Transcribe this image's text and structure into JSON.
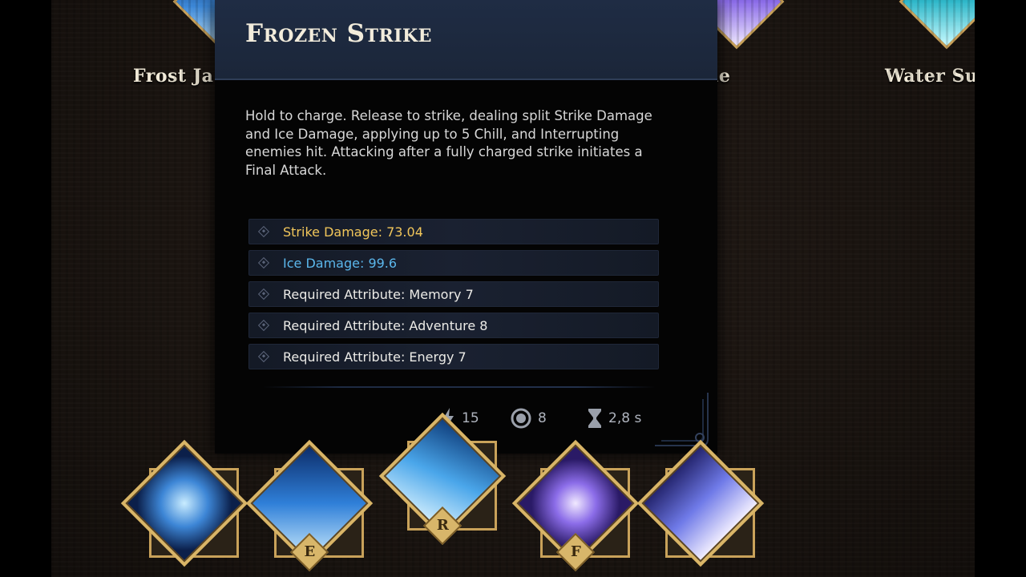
{
  "background_skills": [
    {
      "label": "Frost Ja",
      "key": "frost-javelin"
    },
    {
      "label": "le",
      "key": "hidden-skill"
    },
    {
      "label": "Water Su",
      "key": "water-surge"
    }
  ],
  "tooltip": {
    "title": "Frozen Strike",
    "description": "Hold to charge. Release to strike, dealing split Strike Damage and Ice Damage, applying up to 5 Chill, and Interrupting enemies hit. Attacking after a fully charged strike initiates a Final Attack.",
    "stats": [
      {
        "text": "Strike Damage: 73.04",
        "kind": "strike"
      },
      {
        "text": "Ice Damage: 99.6",
        "kind": "ice"
      },
      {
        "text": "Required Attribute: Memory 7",
        "kind": "req"
      },
      {
        "text": "Required Attribute: Adventure 8",
        "kind": "req"
      },
      {
        "text": "Required Attribute: Energy 7",
        "kind": "req"
      }
    ],
    "footer": {
      "energy_cost": "15",
      "charges": "8",
      "cooldown": "2,8 s"
    }
  },
  "hotbar": {
    "slots": [
      {
        "key_label": "",
        "icon": "frozen-claw-icon",
        "colors": [
          "#0b1f4a",
          "#3d86d6",
          "#c9ecff"
        ]
      },
      {
        "key_label": "E",
        "icon": "ice-shard-icon",
        "colors": [
          "#0b2a66",
          "#2f7fd8",
          "#d6f2ff"
        ]
      },
      {
        "key_label": "R",
        "icon": "ice-spear-icon",
        "colors": [
          "#0e3c7a",
          "#4aa6ea",
          "#e1f6ff"
        ]
      },
      {
        "key_label": "F",
        "icon": "vortex-icon",
        "colors": [
          "#2a1a66",
          "#8b6ce8",
          "#f1e9ff"
        ]
      },
      {
        "key_label": "",
        "icon": "arrow-burst-icon",
        "colors": [
          "#22226a",
          "#6f7ae8",
          "#f4f0ff"
        ]
      }
    ]
  }
}
